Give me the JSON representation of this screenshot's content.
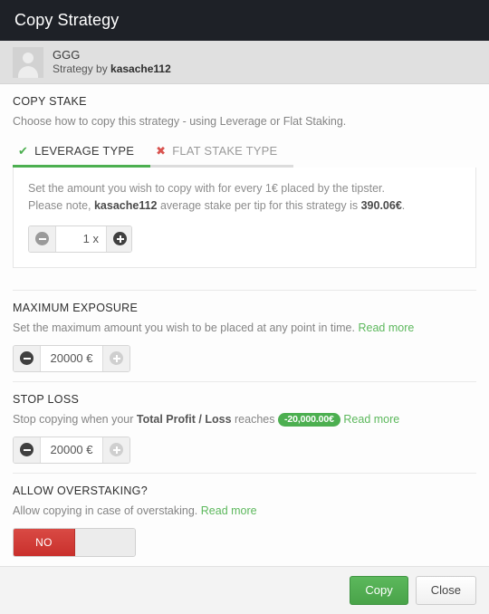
{
  "header": {
    "title": "Copy Strategy"
  },
  "user": {
    "name": "GGG",
    "sub_prefix": "Strategy by ",
    "author": "kasache112",
    "avatar_icon": "user-avatar-icon"
  },
  "copy_stake": {
    "title": "COPY STAKE",
    "description": "Choose how to copy this strategy - using Leverage or Flat Staking.",
    "tabs": [
      {
        "label": "LEVERAGE TYPE",
        "icon": "check-icon",
        "glyph": "✔",
        "active": true
      },
      {
        "label": "FLAT STAKE TYPE",
        "icon": "cross-icon",
        "glyph": "✖",
        "active": false
      }
    ],
    "panel": {
      "line1": "Set the amount you wish to copy with for every 1€ placed by the tipster.",
      "line2_prefix": "Please note, ",
      "line2_author": "kasache112",
      "line2_mid": " average stake per tip for this strategy is ",
      "line2_value": "390.06€",
      "line2_suffix": ".",
      "stepper": {
        "value": "1 x",
        "minus_label": "minus",
        "plus_label": "plus"
      }
    }
  },
  "maximum_exposure": {
    "title": "MAXIMUM EXPOSURE",
    "description": "Set the maximum amount you wish to be placed at any point in time.",
    "read_more": "Read more",
    "stepper": {
      "value": "20000 €"
    }
  },
  "stop_loss": {
    "title": "STOP LOSS",
    "desc_prefix": "Stop copying when your ",
    "desc_bold": "Total Profit / Loss",
    "desc_mid": " reaches ",
    "badge": "-20,000.00€",
    "read_more": "Read more",
    "stepper": {
      "value": "20000 €"
    }
  },
  "allow_overstaking": {
    "title": "ALLOW OVERSTAKING?",
    "description": "Allow copying in case of overstaking.",
    "read_more": "Read more",
    "toggle": {
      "state_label": "NO"
    }
  },
  "footer": {
    "primary": "Copy",
    "secondary": "Close"
  },
  "colors": {
    "header_bg": "#1e2127",
    "accent_green": "#4caf50",
    "danger_red": "#c9302c",
    "user_strip_bg": "#e0e0e0"
  }
}
